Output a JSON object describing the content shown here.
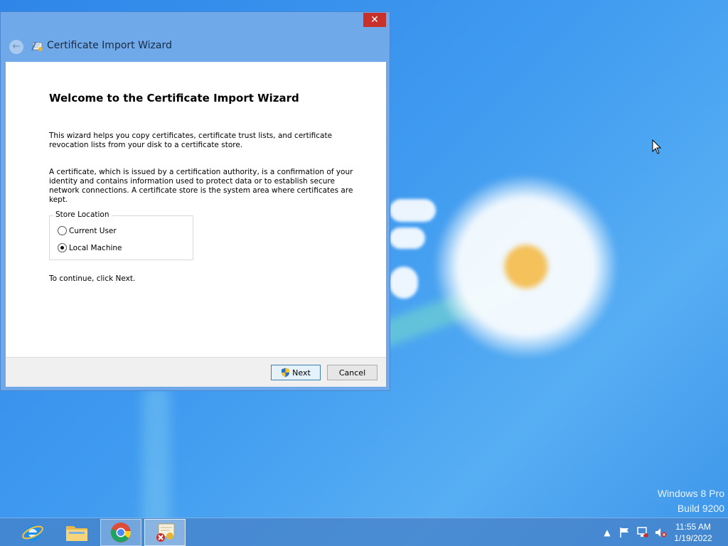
{
  "window": {
    "title": "Certificate Import Wizard",
    "close_glyph": "✕",
    "back_glyph": "←"
  },
  "wizard": {
    "heading": "Welcome to the Certificate Import Wizard",
    "intro": "This wizard helps you copy certificates, certificate trust lists, and certificate revocation lists from your disk to a certificate store.",
    "description": "A certificate, which is issued by a certification authority, is a confirmation of your identity and contains information used to protect data or to establish secure network connections. A certificate store is the system area where certificates are kept.",
    "store_location": {
      "label": "Store Location",
      "options": [
        {
          "label": "Current User",
          "selected": false
        },
        {
          "label": "Local Machine",
          "selected": true
        }
      ]
    },
    "continue_text": "To continue, click Next."
  },
  "buttons": {
    "next": "Next",
    "cancel": "Cancel"
  },
  "desktop": {
    "watermark_line1": "Windows 8 Pro",
    "watermark_line2": "Build 9200"
  },
  "taskbar": {
    "apps": [
      {
        "name": "Internet Explorer",
        "icon": "ie-icon"
      },
      {
        "name": "File Explorer",
        "icon": "folder-icon"
      },
      {
        "name": "Google Chrome",
        "icon": "chrome-icon"
      },
      {
        "name": "Certificate Import Wizard",
        "icon": "certificate-icon"
      }
    ],
    "tray_expand_glyph": "▲",
    "clock_time": "11:55 AM",
    "clock_date": "1/19/2022"
  },
  "colors": {
    "accent": "#6fa9ea",
    "close": "#c7302b",
    "desktop": "#3f9af0"
  }
}
